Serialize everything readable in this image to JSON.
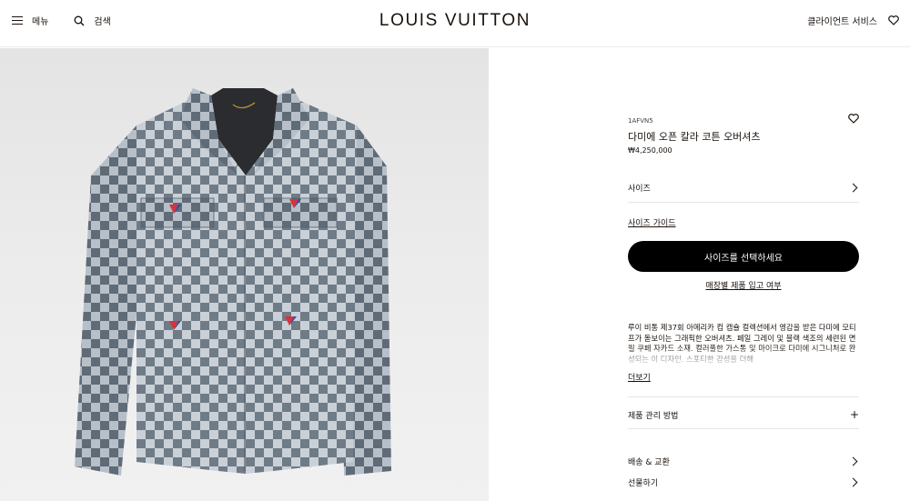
{
  "header": {
    "menu_label": "메뉴",
    "search_label": "검색",
    "brand": "LOUIS VUITTON",
    "client_service": "클라이언트 서비스"
  },
  "product": {
    "sku": "1AFVN5",
    "title": "다미에 오픈 칼라 코튼 오버셔츠",
    "price": "₩4,250,000",
    "size_row": "사이즈",
    "size_guide": "사이즈 가이드",
    "cta": "사이즈를 선택하세요",
    "store_stock": "매장별 제품 입고 여부",
    "description": "루이 비통 제37회 아메리카 컵 캡슐 컬렉션에서 영감을 받은 다미에 모티프가 돋보이는 그래픽한 오버셔츠. 페일 그레이 및 블랙 색조의 세련된 면 필 쿠페 자카드 소재. 컬러풀한 가스통 및 마이크로 다미에 시그니처로 완성되는 이 디자인. 스포티한 감성을 더해",
    "read_more": "더보기",
    "care": "제품 관리 방법",
    "shipping": "배송 & 교환",
    "gift": "선물하기"
  },
  "colors": {
    "ink": "#19110b",
    "cta_bg": "#000000",
    "check_light": "#c9d0d7",
    "check_dark": "#6f7b86",
    "v_red": "#d8323c",
    "v_blue": "#2c4aa8"
  },
  "icons": [
    "menu-icon",
    "search-icon",
    "heart-icon",
    "chevron-right-icon",
    "plus-icon"
  ]
}
